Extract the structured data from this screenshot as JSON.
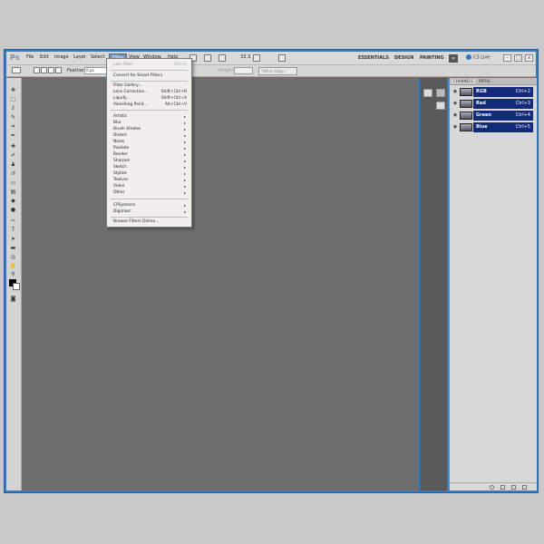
{
  "app": {
    "logo": "Ps"
  },
  "menubar": {
    "items": [
      "File",
      "Edit",
      "Image",
      "Layer",
      "Select",
      "Filter",
      "View",
      "Window",
      "Help"
    ],
    "zoom": "33.3",
    "workspaces": [
      "ESSENTIALS",
      "DESIGN",
      "PAINTING"
    ],
    "overflow_glyph": "»",
    "cslive": "CS Live",
    "window_buttons": [
      "–",
      "□",
      "x"
    ]
  },
  "options": {
    "feather_label": "Feather:",
    "feather_value": "0 px",
    "height_label": "Height:",
    "refine_edge": "Refine Edge..."
  },
  "filter_menu": {
    "last_filter": "Last Filter",
    "last_filter_shortcut": "Ctrl+F",
    "smart_filters": "Convert for Smart Filters",
    "group1": [
      {
        "label": "Filter Gallery...",
        "shortcut": ""
      },
      {
        "label": "Lens Correction...",
        "shortcut": "Shift+Ctrl+R"
      },
      {
        "label": "Liquify...",
        "shortcut": "Shift+Ctrl+X"
      },
      {
        "label": "Vanishing Point...",
        "shortcut": "Alt+Ctrl+V"
      }
    ],
    "submenus": [
      "Artistic",
      "Blur",
      "Brush Strokes",
      "Distort",
      "Noise",
      "Pixelate",
      "Render",
      "Sharpen",
      "Sketch",
      "Stylize",
      "Texture",
      "Video",
      "Other"
    ],
    "plugins": [
      "CPSystems",
      "Digimarc"
    ],
    "browse": "Browse Filters Online..."
  },
  "channels_panel": {
    "tabs": [
      "CHANNELS",
      "PATHS"
    ],
    "channels": [
      {
        "name": "RGB",
        "shortcut": "Ctrl+2"
      },
      {
        "name": "Red",
        "shortcut": "Ctrl+3"
      },
      {
        "name": "Green",
        "shortcut": "Ctrl+4"
      },
      {
        "name": "Blue",
        "shortcut": "Ctrl+5"
      }
    ]
  },
  "icons": {
    "eye": "eye-icon",
    "submenu_arrow": "▸"
  },
  "colors": {
    "title_blue": "#3b79b8",
    "canvas_gray": "#6e6e6e",
    "menu_highlight": "#7c93b7",
    "channel_selected": "#112a7a",
    "foreground": "#000000",
    "background": "#ffffff"
  }
}
